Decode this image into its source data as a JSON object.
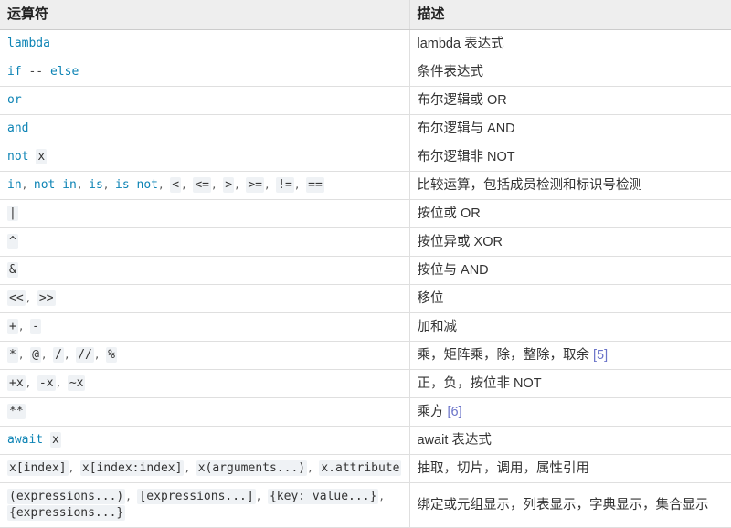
{
  "table": {
    "headers": {
      "operator": "运算符",
      "description": "描述"
    },
    "rows": [
      {
        "operator_text": "lambda",
        "description": "lambda 表达式",
        "tokens": [
          {
            "kind": "kw",
            "text": "lambda"
          }
        ]
      },
      {
        "operator_text": "if -- else",
        "description": "条件表达式",
        "tokens": [
          {
            "kind": "kw",
            "text": "if"
          },
          {
            "kind": "space",
            "text": " "
          },
          {
            "kind": "dashes",
            "text": "--"
          },
          {
            "kind": "space",
            "text": " "
          },
          {
            "kind": "kw",
            "text": "else"
          }
        ]
      },
      {
        "operator_text": "or",
        "description": "布尔逻辑或 OR",
        "tokens": [
          {
            "kind": "kw",
            "text": "or"
          }
        ]
      },
      {
        "operator_text": "and",
        "description": "布尔逻辑与 AND",
        "tokens": [
          {
            "kind": "kw",
            "text": "and"
          }
        ]
      },
      {
        "operator_text": "not x",
        "description": "布尔逻辑非 NOT",
        "tokens": [
          {
            "kind": "kw",
            "text": "not"
          },
          {
            "kind": "space",
            "text": " "
          },
          {
            "kind": "code",
            "text": "x"
          }
        ]
      },
      {
        "operator_text": "in, not in, is, is not, <, <=, >, >=, !=, ==",
        "description": "比较运算，包括成员检测和标识号检测",
        "tokens": [
          {
            "kind": "kw",
            "text": "in"
          },
          {
            "kind": "sep",
            "text": ", "
          },
          {
            "kind": "kw",
            "text": "not in"
          },
          {
            "kind": "sep",
            "text": ", "
          },
          {
            "kind": "kw",
            "text": "is"
          },
          {
            "kind": "sep",
            "text": ", "
          },
          {
            "kind": "kw",
            "text": "is not"
          },
          {
            "kind": "sep",
            "text": ", "
          },
          {
            "kind": "code",
            "text": "<"
          },
          {
            "kind": "sep",
            "text": ", "
          },
          {
            "kind": "code",
            "text": "<="
          },
          {
            "kind": "sep",
            "text": ", "
          },
          {
            "kind": "code",
            "text": ">"
          },
          {
            "kind": "sep",
            "text": ", "
          },
          {
            "kind": "code",
            "text": ">="
          },
          {
            "kind": "sep",
            "text": ", "
          },
          {
            "kind": "code",
            "text": "!="
          },
          {
            "kind": "sep",
            "text": ", "
          },
          {
            "kind": "code",
            "text": "=="
          }
        ]
      },
      {
        "operator_text": "|",
        "description": "按位或 OR",
        "tokens": [
          {
            "kind": "code",
            "text": "|"
          }
        ]
      },
      {
        "operator_text": "^",
        "description": "按位异或 XOR",
        "tokens": [
          {
            "kind": "code",
            "text": "^"
          }
        ]
      },
      {
        "operator_text": "&",
        "description": "按位与 AND",
        "tokens": [
          {
            "kind": "code",
            "text": "&"
          }
        ]
      },
      {
        "operator_text": "<<, >>",
        "description": "移位",
        "tokens": [
          {
            "kind": "code",
            "text": "<<"
          },
          {
            "kind": "sep",
            "text": ", "
          },
          {
            "kind": "code",
            "text": ">>"
          }
        ]
      },
      {
        "operator_text": "+, -",
        "description": "加和减",
        "tokens": [
          {
            "kind": "code",
            "text": "+"
          },
          {
            "kind": "sep",
            "text": ", "
          },
          {
            "kind": "code",
            "text": "-"
          }
        ]
      },
      {
        "operator_text": "*, @, /, //, %",
        "description": "乘，矩阵乘，除，整除，取余 ",
        "description_ref": "[5]",
        "tokens": [
          {
            "kind": "code",
            "text": "*"
          },
          {
            "kind": "sep",
            "text": ", "
          },
          {
            "kind": "code",
            "text": "@"
          },
          {
            "kind": "sep",
            "text": ", "
          },
          {
            "kind": "code",
            "text": "/"
          },
          {
            "kind": "sep",
            "text": ", "
          },
          {
            "kind": "code",
            "text": "//"
          },
          {
            "kind": "sep",
            "text": ", "
          },
          {
            "kind": "code",
            "text": "%"
          }
        ]
      },
      {
        "operator_text": "+x, -x, ~x",
        "description": "正，负，按位非 NOT",
        "tokens": [
          {
            "kind": "code",
            "text": "+x"
          },
          {
            "kind": "sep",
            "text": ", "
          },
          {
            "kind": "code",
            "text": "-x"
          },
          {
            "kind": "sep",
            "text": ", "
          },
          {
            "kind": "code",
            "text": "~x"
          }
        ]
      },
      {
        "operator_text": "**",
        "description": "乘方 ",
        "description_ref": "[6]",
        "tokens": [
          {
            "kind": "code",
            "text": "**"
          }
        ]
      },
      {
        "operator_text": "await x",
        "description": "await 表达式",
        "tokens": [
          {
            "kind": "kw",
            "text": "await"
          },
          {
            "kind": "space",
            "text": " "
          },
          {
            "kind": "code",
            "text": "x"
          }
        ]
      },
      {
        "operator_text": "x[index], x[index:index], x(arguments...), x.attribute",
        "description": "抽取，切片，调用，属性引用",
        "tokens": [
          {
            "kind": "code",
            "text": "x[index]"
          },
          {
            "kind": "sep",
            "text": ", "
          },
          {
            "kind": "code",
            "text": "x[index:index]"
          },
          {
            "kind": "sep",
            "text": ", "
          },
          {
            "kind": "code",
            "text": "x(arguments...)"
          },
          {
            "kind": "sep",
            "text": ", "
          },
          {
            "kind": "code",
            "text": "x.attribute"
          }
        ]
      },
      {
        "operator_text": "(expressions...), [expressions...], {key: value...}, {expressions...}",
        "description": "绑定或元组显示，列表显示，字典显示，集合显示",
        "tokens": [
          {
            "kind": "code",
            "text": "(expressions...)"
          },
          {
            "kind": "sep",
            "text": ", "
          },
          {
            "kind": "code",
            "text": "[expressions...]"
          },
          {
            "kind": "sep",
            "text": ", "
          },
          {
            "kind": "code",
            "text": "{key: value...}"
          },
          {
            "kind": "sep",
            "text": ", "
          },
          {
            "kind": "code",
            "text": "{expressions...}"
          }
        ]
      }
    ]
  },
  "colors": {
    "header_bg": "#eeeeee",
    "keyword_blue": "#0e84b5",
    "code_chip_bg": "#eff2f5",
    "footnote_link": "#6b74c9",
    "row_border": "#dfdfdf",
    "text": "#333333"
  }
}
